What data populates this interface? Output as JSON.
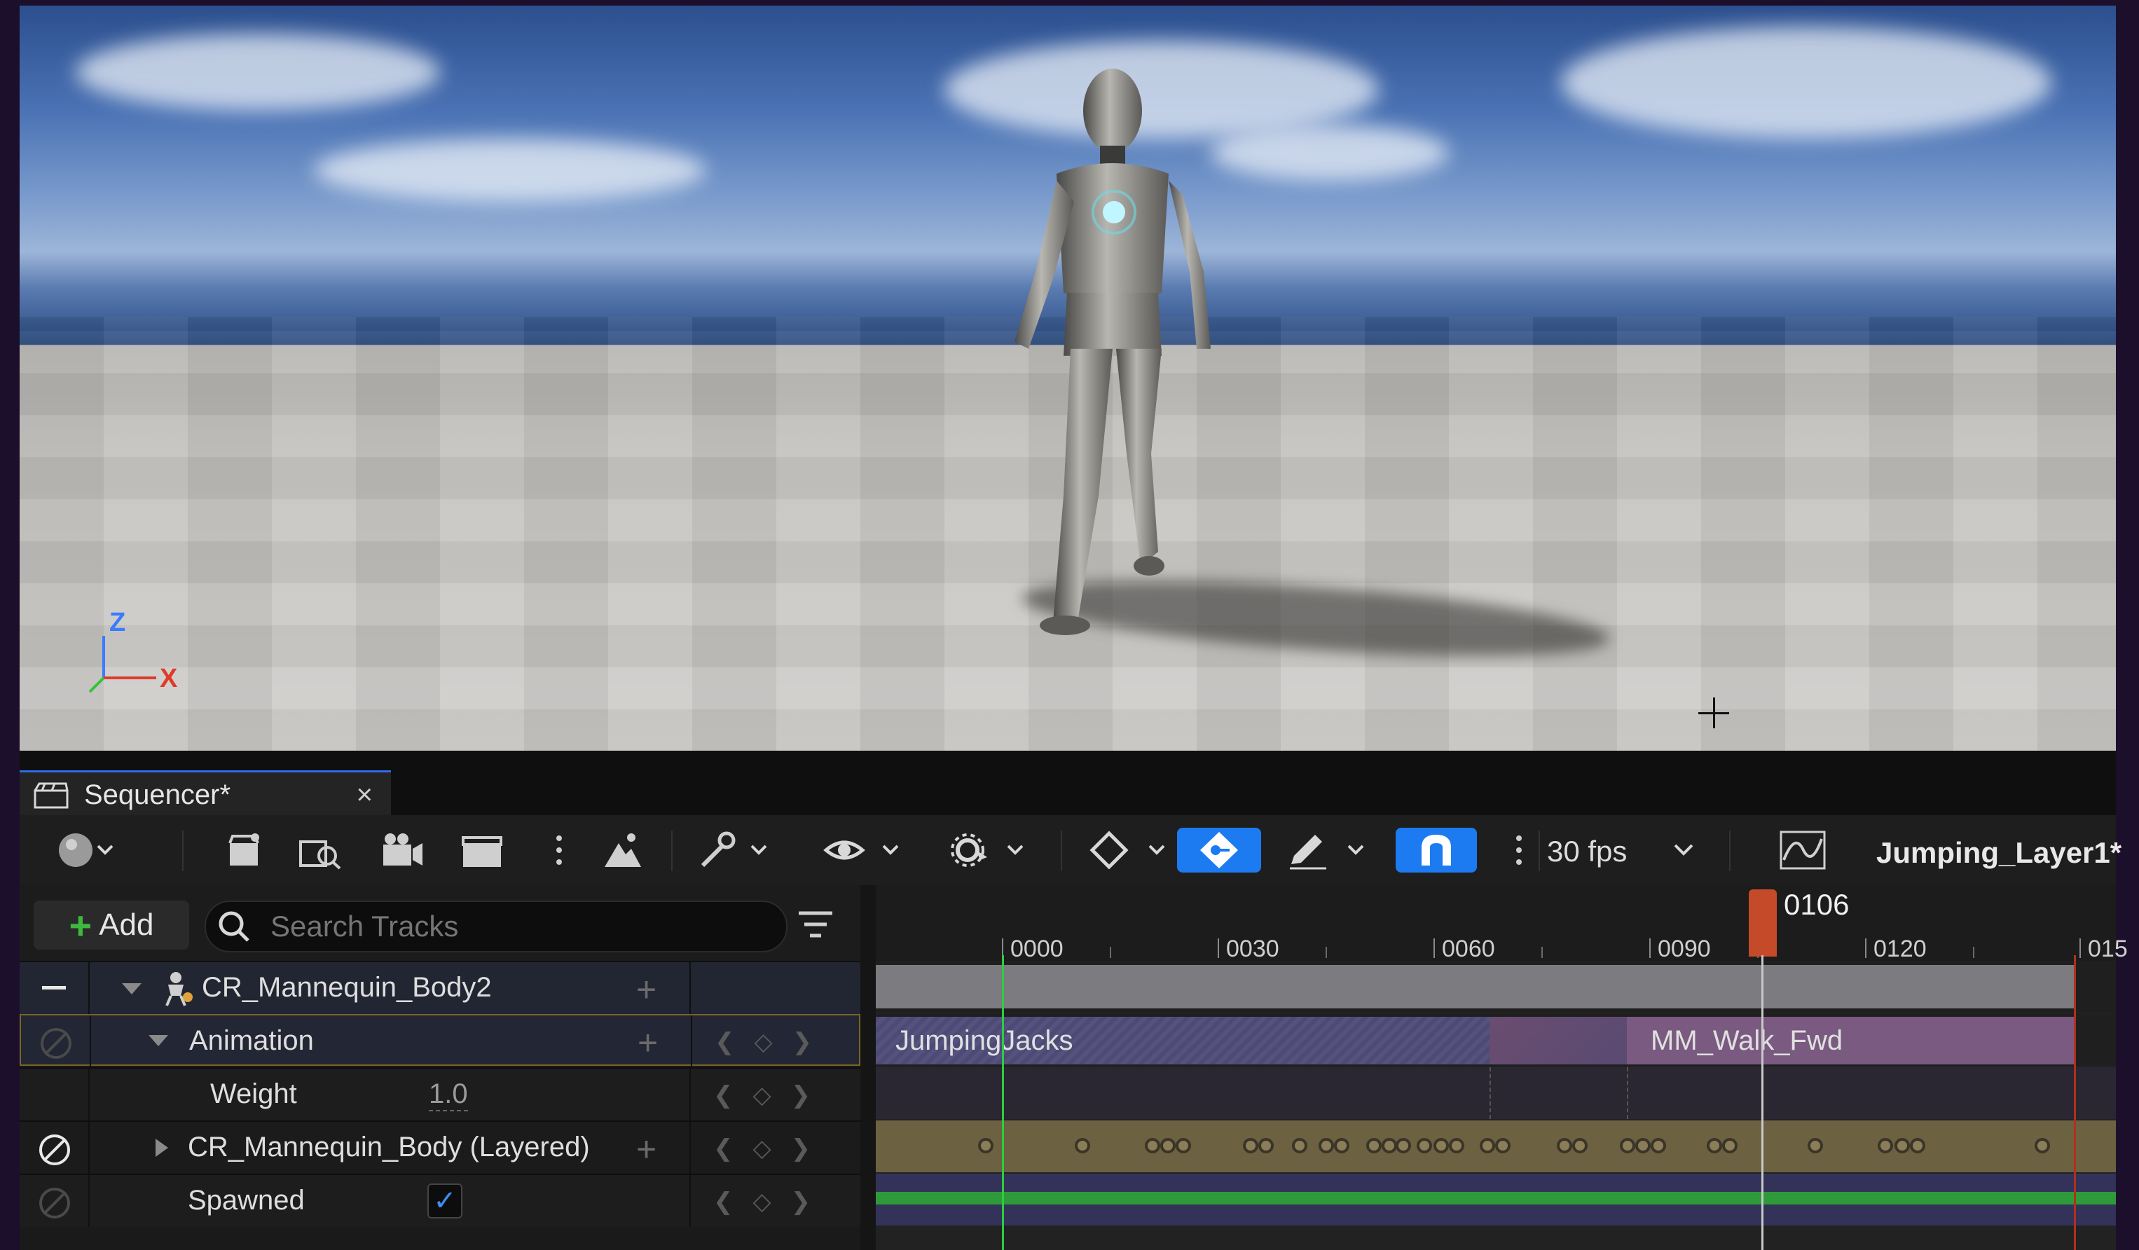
{
  "viewport": {
    "axis_z": "Z",
    "axis_x": "X"
  },
  "tab": {
    "title": "Sequencer*",
    "close": "×"
  },
  "toolbar": {
    "fps_label": "30 fps",
    "sequence_name": "Jumping_Layer1*",
    "icons": [
      "world-icon",
      "save-icon",
      "browse-icon",
      "camera-icon",
      "clapper-icon",
      "more-icon",
      "render-icon",
      "wrench-icon",
      "eye-icon",
      "gear-icon",
      "key-icon",
      "auto-key-icon",
      "pen-icon",
      "snap-icon",
      "curve-editor-icon"
    ]
  },
  "outliner": {
    "add_label": "Add",
    "search_placeholder": "Search Tracks",
    "rows": [
      {
        "label": "CR_Mannequin_Body2",
        "type": "actor"
      },
      {
        "label": "Animation",
        "type": "track"
      },
      {
        "label": "Weight",
        "value": "1.0",
        "type": "property"
      },
      {
        "label": "CR_Mannequin_Body (Layered)",
        "type": "track"
      },
      {
        "label": "Spawned",
        "checked": true,
        "type": "property"
      }
    ]
  },
  "timeline": {
    "current_frame": "0106",
    "ticks": [
      "0000",
      "0030",
      "0060",
      "0090",
      "0120",
      "015"
    ],
    "sections": [
      {
        "label": "JumpingJacks"
      },
      {
        "label": "MM_Walk_Fwd"
      }
    ]
  },
  "colors": {
    "accent_blue": "#1c7bf0",
    "playhead": "#c44a2a",
    "start_marker": "#2ecc40",
    "end_marker": "#b0301c",
    "spawn_track": "#2f9a3a"
  }
}
